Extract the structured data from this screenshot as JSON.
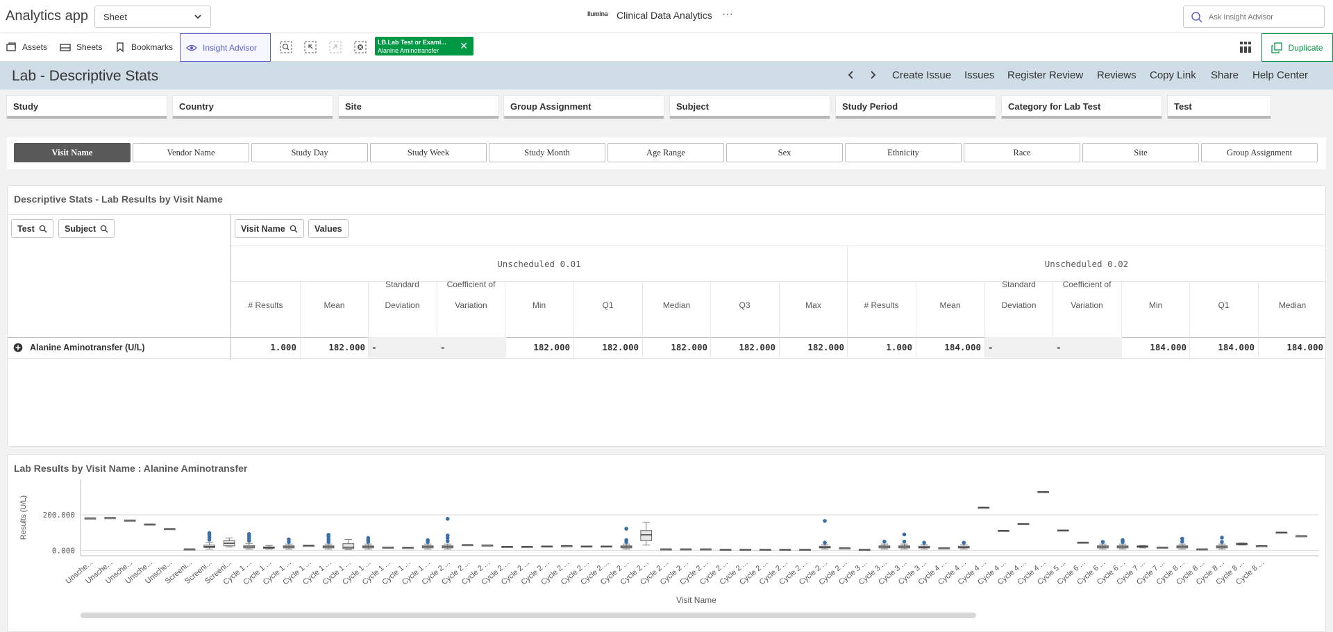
{
  "topbar": {
    "app_name": "Analytics app",
    "sheet_select_value": "Sheet",
    "logo_text": "Ilumina",
    "center_title": "Clinical Data Analytics",
    "more": "···",
    "ask_placeholder": "Ask Insight Advisor"
  },
  "toolbar": {
    "assets": "Assets",
    "sheets": "Sheets",
    "bookmarks": "Bookmarks",
    "insight_advisor": "Insight Advisor",
    "selection_chip": {
      "field": "LB.Lab Test or Exami...",
      "value": "Alanine Aminotransfer"
    },
    "duplicate": "Duplicate",
    "accent_color": "#009845",
    "insight_color": "#5b5fc7"
  },
  "titlebar": {
    "title": "Lab - Descriptive Stats",
    "prev": "‹",
    "next": "›",
    "links": [
      "Create Issue",
      "Issues",
      "Register Review",
      "Reviews",
      "Copy Link",
      "Share",
      "Help Center"
    ]
  },
  "filters": [
    "Study",
    "Country",
    "Site",
    "Group Assignment",
    "Subject",
    "Study Period",
    "Category for Lab Test",
    "Test"
  ],
  "dimensions": {
    "active": "Visit Name",
    "items": [
      "Visit Name",
      "Vendor Name",
      "Study Day",
      "Study Week",
      "Study Month",
      "Age Range",
      "Sex",
      "Ethnicity",
      "Race",
      "Site",
      "Group Assignment"
    ]
  },
  "table": {
    "title": "Descriptive Stats - Lab Results by Visit Name",
    "row_dims": [
      "Test",
      "Subject"
    ],
    "col_dims": [
      "Visit Name",
      "Values"
    ],
    "groups": [
      "Unscheduled 0.01",
      "Unscheduled 0.02"
    ],
    "columns": [
      {
        "l1": "",
        "l2": "# Results"
      },
      {
        "l1": "",
        "l2": "Mean"
      },
      {
        "l1": "Standard",
        "l2": "Deviation"
      },
      {
        "l1": "Coefficient of",
        "l2": "Variation"
      },
      {
        "l1": "",
        "l2": "Min"
      },
      {
        "l1": "",
        "l2": "Q1"
      },
      {
        "l1": "",
        "l2": "Median"
      },
      {
        "l1": "",
        "l2": "Q3"
      },
      {
        "l1": "",
        "l2": "Max"
      },
      {
        "l1": "",
        "l2": "# Results"
      },
      {
        "l1": "",
        "l2": "Mean"
      },
      {
        "l1": "Standard",
        "l2": "Deviation"
      },
      {
        "l1": "Coefficient of",
        "l2": "Variation"
      },
      {
        "l1": "",
        "l2": "Min"
      },
      {
        "l1": "",
        "l2": "Q1"
      },
      {
        "l1": "",
        "l2": "Median"
      }
    ],
    "row": {
      "label": "Alanine Aminotransfer (U/L)",
      "values": [
        "1.000",
        "182.000",
        "-",
        "-",
        "182.000",
        "182.000",
        "182.000",
        "182.000",
        "182.000",
        "1.000",
        "184.000",
        "-",
        "-",
        "184.000",
        "184.000",
        "184.000"
      ]
    }
  },
  "chart_data": {
    "type": "box",
    "title": "Lab Results by Visit Name : Alanine Aminotransfer",
    "xlabel": "Visit Name",
    "ylabel": "Results (U/L)",
    "yticks": [
      "0.000",
      "200.000"
    ],
    "ylim": [
      -10,
      380
    ],
    "grid": true,
    "categories": [
      "Unsche...",
      "Unsche...",
      "Unsche...",
      "Unsche...",
      "Unsche...",
      "Screeni...",
      "Screeni...",
      "Screeni...",
      "Cycle 1 ...",
      "Cycle 1 ...",
      "Cycle 1 ...",
      "Cycle 1 ...",
      "Cycle 1 ...",
      "Cycle 1 ...",
      "Cycle 1 ...",
      "Cycle 1 ...",
      "Cycle 1 ...",
      "Cycle 1 ...",
      "Cycle 2 ...",
      "Cycle 2 ...",
      "Cycle 2 ...",
      "Cycle 2 ...",
      "Cycle 2 ...",
      "Cycle 2 ...",
      "Cycle 2 ...",
      "Cycle 2 ...",
      "Cycle 2 ...",
      "Cycle 2 ...",
      "Cycle 2 ...",
      "Cycle 2 ...",
      "Cycle 2 ...",
      "Cycle 2 ...",
      "Cycle 2 ...",
      "Cycle 2 ...",
      "Cycle 2 ...",
      "Cycle 2 ...",
      "Cycle 2 ...",
      "Cycle 2 ...",
      "Cycle 2 ...",
      "Cycle 3 ...",
      "Cycle 3 ...",
      "Cycle 3 ...",
      "Cycle 3 ...",
      "Cycle 4 ...",
      "Cycle 4 ...",
      "Cycle 4 ...",
      "Cycle 4 ...",
      "Cycle 4 ...",
      "Cycle 4 ...",
      "Cycle 5 ...",
      "Cycle 6 ...",
      "Cycle 6 ...",
      "Cycle 6 ...",
      "Cycle 7 ...",
      "Cycle 7 ...",
      "Cycle 8 ...",
      "Cycle 8 ...",
      "Cycle 8 ...",
      "Cycle 8 ...",
      "Cycle 8 ..."
    ],
    "boxes": [
      {
        "q1": 182,
        "med": 182,
        "q3": 182,
        "lo": 182,
        "hi": 182,
        "out": []
      },
      {
        "q1": 184,
        "med": 184,
        "q3": 184,
        "lo": 184,
        "hi": 184,
        "out": []
      },
      {
        "q1": 170,
        "med": 170,
        "q3": 170,
        "lo": 170,
        "hi": 170,
        "out": []
      },
      {
        "q1": 148,
        "med": 148,
        "q3": 148,
        "lo": 148,
        "hi": 148,
        "out": []
      },
      {
        "q1": 122,
        "med": 122,
        "q3": 122,
        "lo": 122,
        "hi": 122,
        "out": []
      },
      {
        "q1": 8,
        "med": 8,
        "q3": 8,
        "lo": 8,
        "hi": 8,
        "out": []
      },
      {
        "q1": 16,
        "med": 22,
        "q3": 30,
        "lo": 8,
        "hi": 45,
        "out": [
          60,
          75,
          88,
          98
        ]
      },
      {
        "q1": 26,
        "med": 40,
        "q3": 55,
        "lo": 20,
        "hi": 70,
        "out": []
      },
      {
        "q1": 14,
        "med": 20,
        "q3": 28,
        "lo": 8,
        "hi": 40,
        "out": [
          55,
          68,
          80,
          92
        ]
      },
      {
        "q1": 12,
        "med": 16,
        "q3": 20,
        "lo": 8,
        "hi": 28,
        "out": []
      },
      {
        "q1": 14,
        "med": 20,
        "q3": 26,
        "lo": 8,
        "hi": 36,
        "out": [
          48,
          62
        ]
      },
      {
        "q1": 28,
        "med": 28,
        "q3": 28,
        "lo": 28,
        "hi": 28,
        "out": []
      },
      {
        "q1": 14,
        "med": 20,
        "q3": 26,
        "lo": 8,
        "hi": 36,
        "out": [
          48,
          62,
          78,
          88
        ]
      },
      {
        "q1": 10,
        "med": 18,
        "q3": 38,
        "lo": 5,
        "hi": 62,
        "out": []
      },
      {
        "q1": 14,
        "med": 20,
        "q3": 26,
        "lo": 8,
        "hi": 36,
        "out": [
          48,
          58,
          70
        ]
      },
      {
        "q1": 18,
        "med": 18,
        "q3": 18,
        "lo": 18,
        "hi": 18,
        "out": []
      },
      {
        "q1": 16,
        "med": 16,
        "q3": 16,
        "lo": 16,
        "hi": 16,
        "out": []
      },
      {
        "q1": 14,
        "med": 20,
        "q3": 26,
        "lo": 8,
        "hi": 36,
        "out": [
          48,
          58
        ]
      },
      {
        "q1": 14,
        "med": 20,
        "q3": 26,
        "lo": 8,
        "hi": 36,
        "out": [
          52,
          70,
          84,
          178
        ]
      },
      {
        "q1": 32,
        "med": 32,
        "q3": 32,
        "lo": 32,
        "hi": 32,
        "out": []
      },
      {
        "q1": 30,
        "med": 30,
        "q3": 30,
        "lo": 30,
        "hi": 30,
        "out": []
      },
      {
        "q1": 22,
        "med": 22,
        "q3": 22,
        "lo": 22,
        "hi": 22,
        "out": []
      },
      {
        "q1": 22,
        "med": 22,
        "q3": 22,
        "lo": 22,
        "hi": 22,
        "out": []
      },
      {
        "q1": 24,
        "med": 24,
        "q3": 24,
        "lo": 24,
        "hi": 24,
        "out": []
      },
      {
        "q1": 26,
        "med": 26,
        "q3": 26,
        "lo": 26,
        "hi": 26,
        "out": []
      },
      {
        "q1": 24,
        "med": 24,
        "q3": 24,
        "lo": 24,
        "hi": 24,
        "out": []
      },
      {
        "q1": 24,
        "med": 24,
        "q3": 24,
        "lo": 24,
        "hi": 24,
        "out": []
      },
      {
        "q1": 14,
        "med": 20,
        "q3": 26,
        "lo": 8,
        "hi": 36,
        "out": [
          48,
          58,
          122
        ]
      },
      {
        "q1": 55,
        "med": 88,
        "q3": 112,
        "lo": 30,
        "hi": 158,
        "out": []
      },
      {
        "q1": 8,
        "med": 8,
        "q3": 8,
        "lo": 8,
        "hi": 8,
        "out": []
      },
      {
        "q1": 8,
        "med": 8,
        "q3": 8,
        "lo": 8,
        "hi": 8,
        "out": []
      },
      {
        "q1": 8,
        "med": 8,
        "q3": 8,
        "lo": 8,
        "hi": 8,
        "out": []
      },
      {
        "q1": 6,
        "med": 6,
        "q3": 6,
        "lo": 6,
        "hi": 6,
        "out": []
      },
      {
        "q1": 6,
        "med": 6,
        "q3": 6,
        "lo": 6,
        "hi": 6,
        "out": []
      },
      {
        "q1": 6,
        "med": 6,
        "q3": 6,
        "lo": 6,
        "hi": 6,
        "out": []
      },
      {
        "q1": 6,
        "med": 6,
        "q3": 6,
        "lo": 6,
        "hi": 6,
        "out": []
      },
      {
        "q1": 6,
        "med": 6,
        "q3": 6,
        "lo": 6,
        "hi": 6,
        "out": []
      },
      {
        "q1": 14,
        "med": 18,
        "q3": 24,
        "lo": 8,
        "hi": 32,
        "out": [
          44,
          166
        ]
      },
      {
        "q1": 14,
        "med": 14,
        "q3": 14,
        "lo": 14,
        "hi": 14,
        "out": []
      },
      {
        "q1": 6,
        "med": 6,
        "q3": 6,
        "lo": 6,
        "hi": 6,
        "out": []
      },
      {
        "q1": 14,
        "med": 20,
        "q3": 26,
        "lo": 8,
        "hi": 36,
        "out": [
          50
        ]
      },
      {
        "q1": 14,
        "med": 20,
        "q3": 26,
        "lo": 8,
        "hi": 36,
        "out": [
          50,
          90
        ]
      },
      {
        "q1": 14,
        "med": 18,
        "q3": 24,
        "lo": 8,
        "hi": 32,
        "out": [
          44
        ]
      },
      {
        "q1": 14,
        "med": 14,
        "q3": 14,
        "lo": 14,
        "hi": 14,
        "out": []
      },
      {
        "q1": 14,
        "med": 18,
        "q3": 24,
        "lo": 8,
        "hi": 32,
        "out": [
          44
        ]
      },
      {
        "q1": 242,
        "med": 242,
        "q3": 242,
        "lo": 242,
        "hi": 242,
        "out": []
      },
      {
        "q1": 112,
        "med": 112,
        "q3": 112,
        "lo": 112,
        "hi": 112,
        "out": []
      },
      {
        "q1": 150,
        "med": 150,
        "q3": 150,
        "lo": 150,
        "hi": 150,
        "out": []
      },
      {
        "q1": 330,
        "med": 330,
        "q3": 330,
        "lo": 330,
        "hi": 330,
        "out": []
      },
      {
        "q1": 114,
        "med": 114,
        "q3": 114,
        "lo": 114,
        "hi": 114,
        "out": []
      },
      {
        "q1": 46,
        "med": 46,
        "q3": 46,
        "lo": 46,
        "hi": 46,
        "out": []
      },
      {
        "q1": 14,
        "med": 20,
        "q3": 26,
        "lo": 8,
        "hi": 36,
        "out": [
          48
        ]
      },
      {
        "q1": 14,
        "med": 20,
        "q3": 26,
        "lo": 8,
        "hi": 36,
        "out": [
          48,
          58
        ]
      },
      {
        "q1": 18,
        "med": 22,
        "q3": 26,
        "lo": 14,
        "hi": 28,
        "out": []
      },
      {
        "q1": 18,
        "med": 18,
        "q3": 18,
        "lo": 18,
        "hi": 18,
        "out": []
      },
      {
        "q1": 14,
        "med": 20,
        "q3": 26,
        "lo": 8,
        "hi": 36,
        "out": [
          50,
          66
        ]
      },
      {
        "q1": 8,
        "med": 8,
        "q3": 8,
        "lo": 8,
        "hi": 8,
        "out": []
      },
      {
        "q1": 14,
        "med": 20,
        "q3": 26,
        "lo": 8,
        "hi": 36,
        "out": [
          48,
          72
        ]
      },
      {
        "q1": 32,
        "med": 36,
        "q3": 40,
        "lo": 30,
        "hi": 42,
        "out": []
      },
      {
        "q1": 26,
        "med": 26,
        "q3": 26,
        "lo": 26,
        "hi": 26,
        "out": []
      },
      {
        "q1": 102,
        "med": 102,
        "q3": 102,
        "lo": 102,
        "hi": 102,
        "out": []
      },
      {
        "q1": 82,
        "med": 82,
        "q3": 82,
        "lo": 82,
        "hi": 82,
        "out": []
      }
    ],
    "outlier_color": "#3a6fa8"
  }
}
